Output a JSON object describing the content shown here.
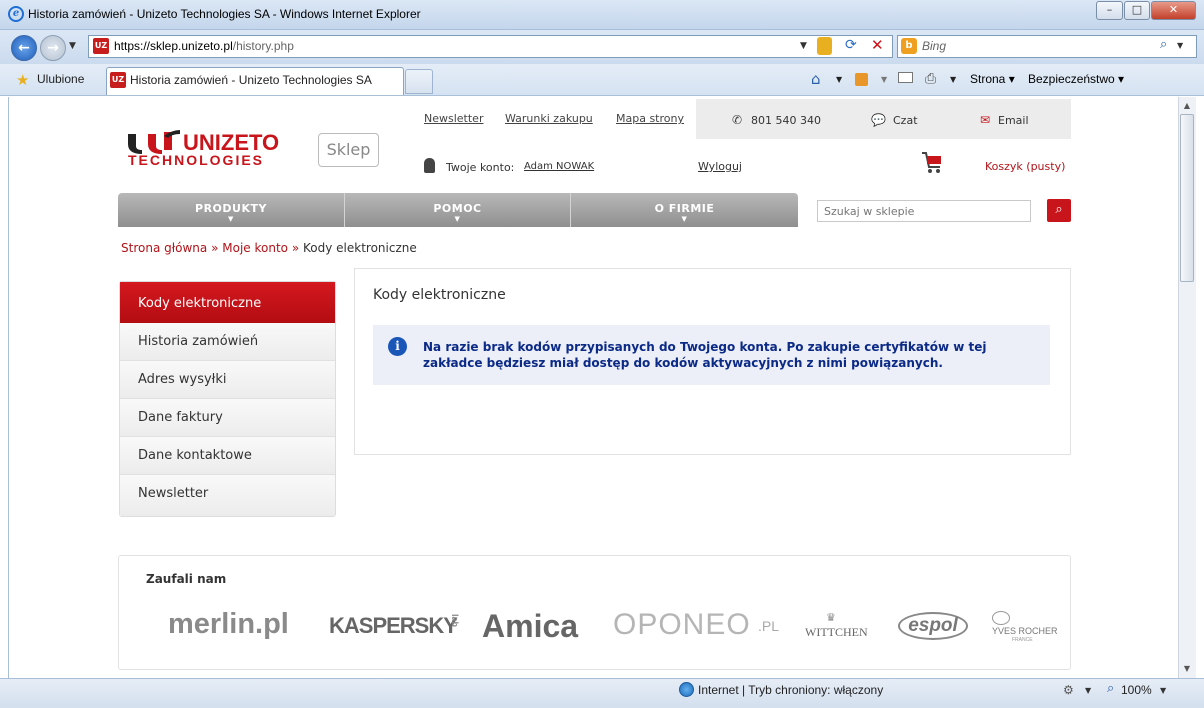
{
  "browser": {
    "window_title": "Historia zamówień - Unizeto Technologies SA - Windows Internet Explorer",
    "address_host": "https://sklep.unizeto.pl",
    "address_path": "/history.php",
    "search_engine": "Bing",
    "favorites_label": "Ulubione",
    "tab_title": "Historia zamówień - Unizeto Technologies SA",
    "cmd_page": "Strona",
    "cmd_safety": "Bezpieczeństwo",
    "status_text": "Internet | Tryb chroniony: włączony",
    "zoom": "100%"
  },
  "header": {
    "logo_name": "UNIZETO",
    "logo_tagline": "TECHNOLOGIES",
    "shop_badge": "Sklep",
    "links": [
      "Newsletter",
      "Warunki zakupu",
      "Mapa strony"
    ],
    "phone": "801 540 340",
    "chat": "Czat",
    "email": "Email",
    "account_label": "Twoje konto:",
    "account_name": "Adam NOWAK",
    "logout": "Wyloguj",
    "cart": "Koszyk (pusty)"
  },
  "menu": {
    "items": [
      "PRODUKTY",
      "POMOC",
      "O FIRMIE"
    ],
    "search_placeholder": "Szukaj w sklepie"
  },
  "breadcrumb": {
    "home": "Strona główna",
    "account": "Moje konto",
    "current": "Kody elektroniczne",
    "separator": "»"
  },
  "sidebar": {
    "items": [
      {
        "label": "Kody elektroniczne",
        "active": true
      },
      {
        "label": "Historia zamówień",
        "active": false
      },
      {
        "label": "Adres wysyłki",
        "active": false
      },
      {
        "label": "Dane faktury",
        "active": false
      },
      {
        "label": "Dane kontaktowe",
        "active": false
      },
      {
        "label": "Newsletter",
        "active": false
      }
    ]
  },
  "content": {
    "title": "Kody elektroniczne",
    "info_message": "Na razie brak kodów przypisanych do Twojego konta. Po zakupie certyfikatów w tej zakładce będziesz miał dostęp do kodów aktywacyjnych z nimi powiązanych."
  },
  "trusted": {
    "title": "Zaufali nam",
    "brands": [
      "merlin.pl",
      "KASPERSKY",
      "lab",
      "Amica",
      "OPONEO",
      ".PL",
      "WITTCHEN",
      "espol",
      "YVES ROCHER",
      "FRANCE"
    ]
  },
  "colors": {
    "brand_red": "#c8141b",
    "info_text": "#0b2a86",
    "info_bg": "#eceef8"
  }
}
